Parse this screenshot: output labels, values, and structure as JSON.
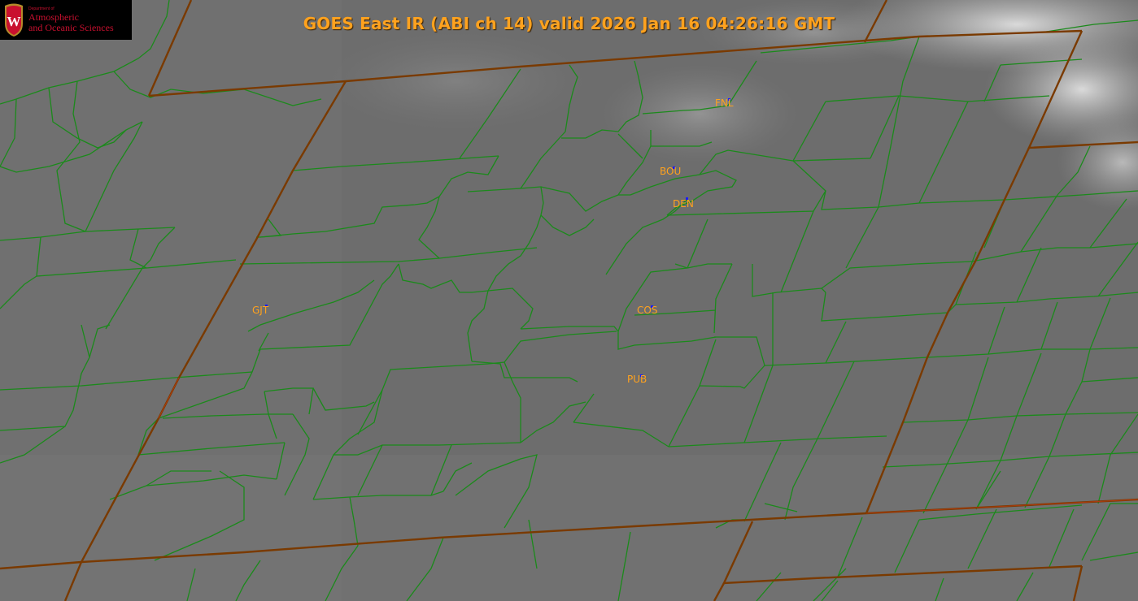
{
  "title": "GOES East IR (ABI ch 14) valid 2026 Jan 16 04:26:16 GMT",
  "logo": {
    "small_text": "Department of",
    "line1": "Atmospheric",
    "line2": "and Oceanic Sciences",
    "shield_letter": "W"
  },
  "stations": [
    {
      "id": "FNL"
    },
    {
      "id": "BOU"
    },
    {
      "id": "DEN"
    },
    {
      "id": "GJT"
    },
    {
      "id": "COS"
    },
    {
      "id": "PUB"
    }
  ],
  "colors": {
    "label": "#ffa21e",
    "county_border": "#1b8a1b",
    "state_border": "#7a3a00",
    "station_marker": "#1a1aff",
    "logo_red": "#c9102f"
  }
}
